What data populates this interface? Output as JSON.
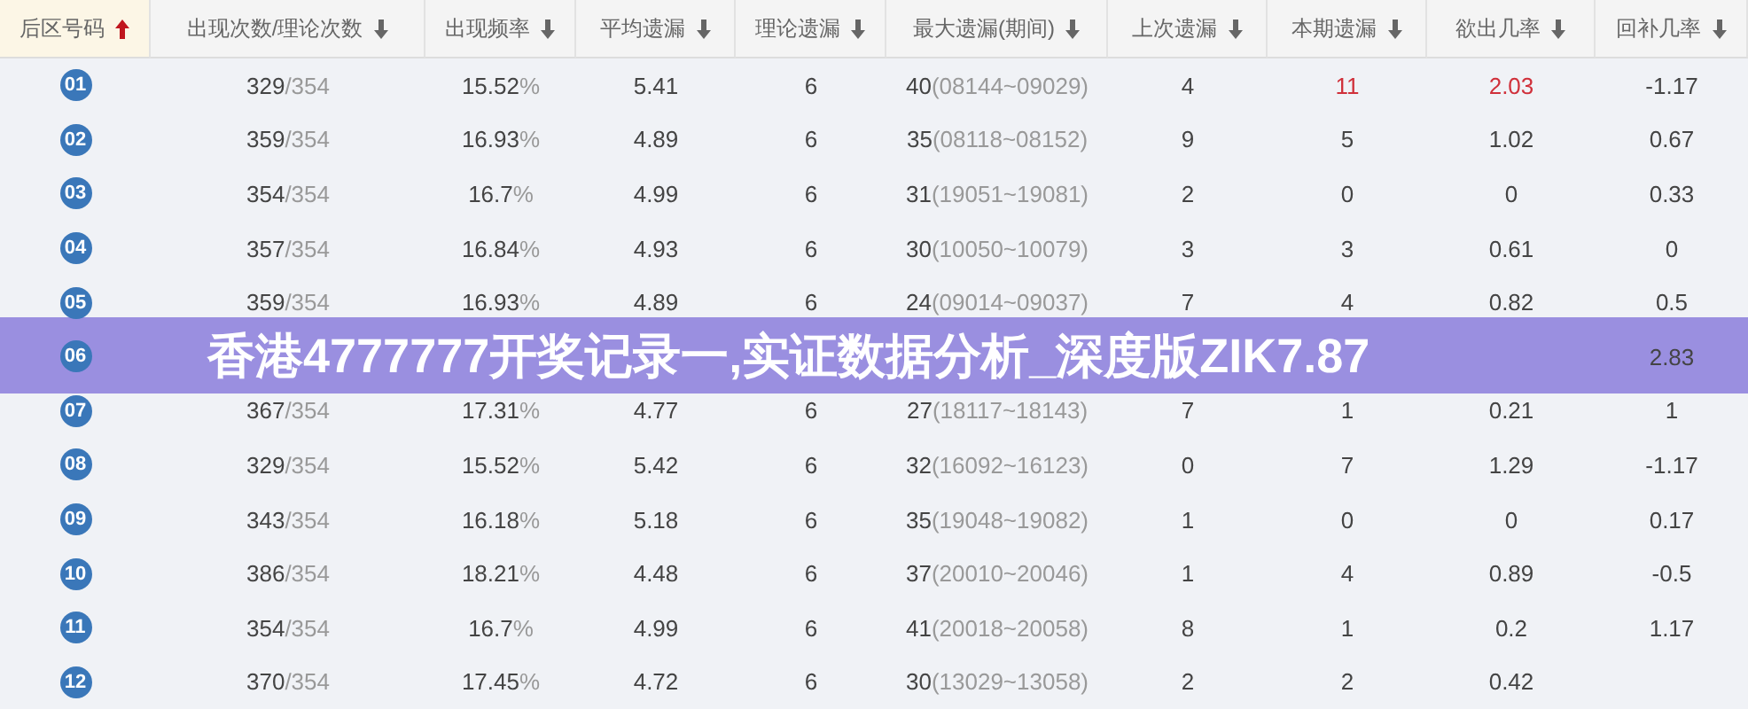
{
  "columns": [
    {
      "label": "后区号码",
      "selected": true
    },
    {
      "label": "出现次数/理论次数",
      "selected": false
    },
    {
      "label": "出现频率",
      "selected": false
    },
    {
      "label": "平均遗漏",
      "selected": false
    },
    {
      "label": "理论遗漏",
      "selected": false
    },
    {
      "label": "最大遗漏(期间)",
      "selected": false
    },
    {
      "label": "上次遗漏",
      "selected": false
    },
    {
      "label": "本期遗漏",
      "selected": false
    },
    {
      "label": "欲出几率",
      "selected": false
    },
    {
      "label": "回补几率",
      "selected": false
    }
  ],
  "rows": [
    {
      "number": "01",
      "alert": true,
      "cells": [
        {
          "text": "329",
          "suffix": "/354"
        },
        {
          "text": "15.52",
          "suffix": "%"
        },
        {
          "text": "5.41"
        },
        {
          "text": "6"
        },
        {
          "text": "40",
          "suffix": "(08144~09029)"
        },
        {
          "text": "4"
        },
        {
          "text": "11"
        },
        {
          "text": "2.03"
        },
        {
          "text": "-1.17"
        }
      ]
    },
    {
      "number": "02",
      "alert": false,
      "cells": [
        {
          "text": "359",
          "suffix": "/354"
        },
        {
          "text": "16.93",
          "suffix": "%"
        },
        {
          "text": "4.89"
        },
        {
          "text": "6"
        },
        {
          "text": "35",
          "suffix": "(08118~08152)"
        },
        {
          "text": "9"
        },
        {
          "text": "5"
        },
        {
          "text": "1.02"
        },
        {
          "text": "0.67"
        }
      ]
    },
    {
      "number": "03",
      "alert": false,
      "cells": [
        {
          "text": "354",
          "suffix": "/354"
        },
        {
          "text": "16.7",
          "suffix": "%"
        },
        {
          "text": "4.99"
        },
        {
          "text": "6"
        },
        {
          "text": "31",
          "suffix": "(19051~19081)"
        },
        {
          "text": "2"
        },
        {
          "text": "0"
        },
        {
          "text": "0"
        },
        {
          "text": "0.33"
        }
      ]
    },
    {
      "number": "04",
      "alert": false,
      "cells": [
        {
          "text": "357",
          "suffix": "/354"
        },
        {
          "text": "16.84",
          "suffix": "%"
        },
        {
          "text": "4.93"
        },
        {
          "text": "6"
        },
        {
          "text": "30",
          "suffix": "(10050~10079)"
        },
        {
          "text": "3"
        },
        {
          "text": "3"
        },
        {
          "text": "0.61"
        },
        {
          "text": "0"
        }
      ]
    },
    {
      "number": "05",
      "alert": false,
      "cells": [
        {
          "text": "359",
          "suffix": "/354"
        },
        {
          "text": "16.93",
          "suffix": "%"
        },
        {
          "text": "4.89"
        },
        {
          "text": "6"
        },
        {
          "text": "24",
          "suffix": "(09014~09037)"
        },
        {
          "text": "7"
        },
        {
          "text": "4"
        },
        {
          "text": "0.82"
        },
        {
          "text": "0.5"
        }
      ]
    },
    {
      "number": "06",
      "cells": [
        null,
        null,
        null,
        null,
        null,
        null,
        null,
        null,
        {
          "text": "2.83"
        }
      ]
    },
    {
      "number": "07",
      "alert": false,
      "cells": [
        {
          "text": "367",
          "suffix": "/354"
        },
        {
          "text": "17.31",
          "suffix": "%"
        },
        {
          "text": "4.77"
        },
        {
          "text": "6"
        },
        {
          "text": "27",
          "suffix": "(18117~18143)"
        },
        {
          "text": "7"
        },
        {
          "text": "1"
        },
        {
          "text": "0.21"
        },
        {
          "text": "1"
        }
      ]
    },
    {
      "number": "08",
      "alert": false,
      "cells": [
        {
          "text": "329",
          "suffix": "/354"
        },
        {
          "text": "15.52",
          "suffix": "%"
        },
        {
          "text": "5.42"
        },
        {
          "text": "6"
        },
        {
          "text": "32",
          "suffix": "(16092~16123)"
        },
        {
          "text": "0"
        },
        {
          "text": "7"
        },
        {
          "text": "1.29"
        },
        {
          "text": "-1.17"
        }
      ]
    },
    {
      "number": "09",
      "alert": false,
      "cells": [
        {
          "text": "343",
          "suffix": "/354"
        },
        {
          "text": "16.18",
          "suffix": "%"
        },
        {
          "text": "5.18"
        },
        {
          "text": "6"
        },
        {
          "text": "35",
          "suffix": "(19048~19082)"
        },
        {
          "text": "1"
        },
        {
          "text": "0"
        },
        {
          "text": "0"
        },
        {
          "text": "0.17"
        }
      ]
    },
    {
      "number": "10",
      "alert": false,
      "cells": [
        {
          "text": "386",
          "suffix": "/354"
        },
        {
          "text": "18.21",
          "suffix": "%"
        },
        {
          "text": "4.48"
        },
        {
          "text": "6"
        },
        {
          "text": "37",
          "suffix": "(20010~20046)"
        },
        {
          "text": "1"
        },
        {
          "text": "4"
        },
        {
          "text": "0.89"
        },
        {
          "text": "-0.5"
        }
      ]
    },
    {
      "number": "11",
      "alert": false,
      "cells": [
        {
          "text": "354",
          "suffix": "/354"
        },
        {
          "text": "16.7",
          "suffix": "%"
        },
        {
          "text": "4.99"
        },
        {
          "text": "6"
        },
        {
          "text": "41",
          "suffix": "(20018~20058)"
        },
        {
          "text": "8"
        },
        {
          "text": "1"
        },
        {
          "text": "0.2"
        },
        {
          "text": "1.17"
        }
      ]
    },
    {
      "number": "12",
      "alert": false,
      "cells": [
        {
          "text": "370",
          "suffix": "/354"
        },
        {
          "text": "17.45",
          "suffix": "%"
        },
        {
          "text": "4.72"
        },
        {
          "text": "6"
        },
        {
          "text": "30",
          "suffix": "(13029~13058)"
        },
        {
          "text": "2"
        },
        {
          "text": "2"
        },
        {
          "text": "0.42"
        },
        null
      ]
    }
  ],
  "banner": {
    "title": "香港4777777开奖记录一,实证数据分析_深度版ZIK7.87"
  }
}
